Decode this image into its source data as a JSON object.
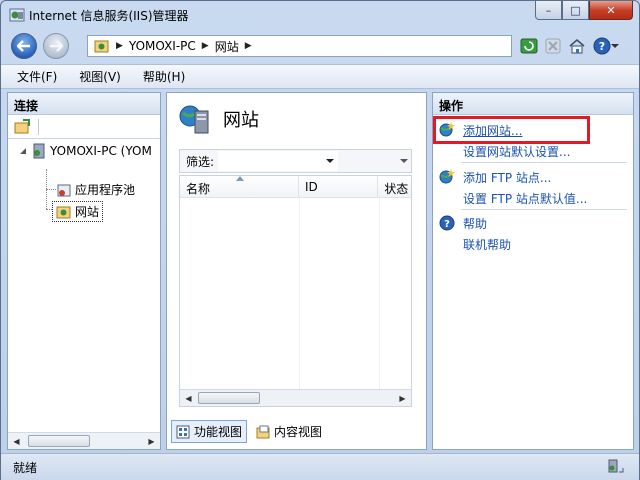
{
  "window": {
    "title": "Internet 信息服务(IIS)管理器",
    "minimize_glyph": "–",
    "maximize_glyph": "□",
    "close_glyph": "✕"
  },
  "address": {
    "segments": [
      "YOMOXI-PC",
      "网站"
    ],
    "separator": "▶"
  },
  "menu": {
    "items": [
      "文件(F)",
      "视图(V)",
      "帮助(H)"
    ]
  },
  "left_pane": {
    "header": "连接",
    "tree": {
      "root": "YOMOXI-PC (YOM",
      "children": [
        "应用程序池",
        "网站"
      ]
    }
  },
  "center_pane": {
    "title": "网站",
    "filter_label": "筛选:",
    "filter_value": "",
    "columns": [
      "名称",
      "ID",
      "状态"
    ],
    "rows": [],
    "view_tabs": [
      "功能视图",
      "内容视图"
    ]
  },
  "right_pane": {
    "header": "操作",
    "groups": [
      {
        "icon": "globe-add-icon",
        "items": [
          "添加网站...",
          "设置网站默认设置..."
        ]
      },
      {
        "icon": "globe-ftp-icon",
        "items": [
          "添加 FTP 站点...",
          "设置 FTP 站点默认值..."
        ]
      },
      {
        "icon": "help-icon",
        "items": [
          "帮助",
          "联机帮助"
        ]
      }
    ]
  },
  "status": {
    "text": "就绪"
  },
  "colors": {
    "link": "#1a52b1",
    "highlight": "#e01b26",
    "accent": "#2a62b8"
  }
}
